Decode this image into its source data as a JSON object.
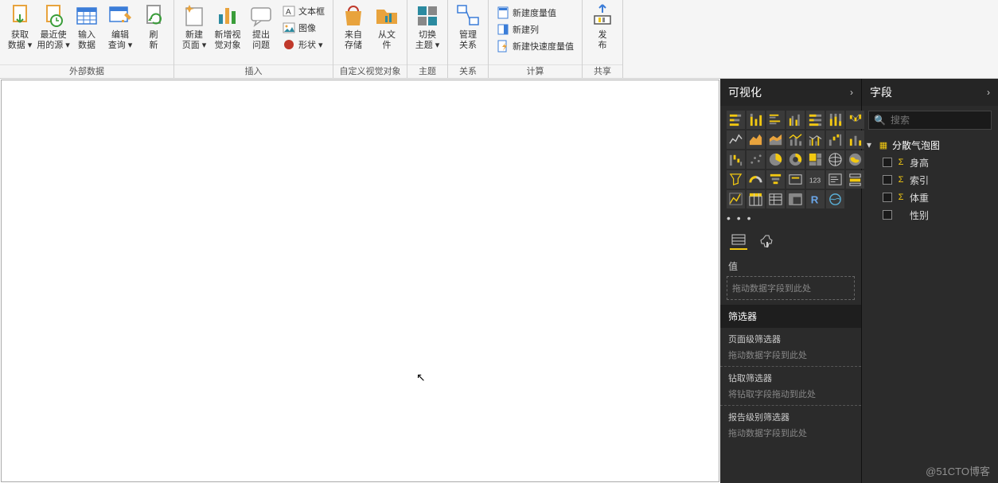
{
  "ribbon": {
    "groups": {
      "external_data": {
        "label": "外部数据",
        "get_data": "获取\n数据 ▾",
        "recent": "最近使\n用的源 ▾",
        "enter_data": "输入\n数据",
        "edit_query": "编辑\n查询 ▾",
        "refresh": "刷\n新"
      },
      "insert": {
        "label": "插入",
        "new_page": "新建\n页面 ▾",
        "new_visual": "新增视\n觉对象",
        "ask_question": "提出\n问题",
        "textbox": "文本框",
        "image": "图像",
        "shape": "形状 ▾"
      },
      "custom_visuals": {
        "label": "自定义视觉对象",
        "from_store": "来自\n存储",
        "from_file": "从文\n件"
      },
      "theme": {
        "label": "主题",
        "switch_theme": "切换\n主题 ▾"
      },
      "relationships": {
        "label": "关系",
        "manage": "管理\n关系"
      },
      "calculation": {
        "label": "计算",
        "new_measure": "新建度量值",
        "new_column": "新建列",
        "quick_measure": "新建快速度量值"
      },
      "share": {
        "label": "共享",
        "publish": "发\n布"
      }
    }
  },
  "viz_panel": {
    "title": "可视化",
    "more": "• • •",
    "value_label": "值",
    "value_placeholder": "拖动数据字段到此处",
    "filters_title": "筛选器",
    "page_filter": "页面级筛选器",
    "page_filter_dz": "拖动数据字段到此处",
    "drill_filter": "钻取筛选器",
    "drill_filter_dz": "将钻取字段拖动到此处",
    "report_filter": "报告级别筛选器",
    "report_filter_dz": "拖动数据字段到此处"
  },
  "fields_panel": {
    "title": "字段",
    "search_placeholder": "搜索",
    "table_name": "分散气泡图",
    "fields": [
      {
        "name": "身高",
        "agg": true
      },
      {
        "name": "索引",
        "agg": true
      },
      {
        "name": "体重",
        "agg": true
      },
      {
        "name": "性别",
        "agg": false
      }
    ]
  },
  "watermark": "@51CTO博客"
}
